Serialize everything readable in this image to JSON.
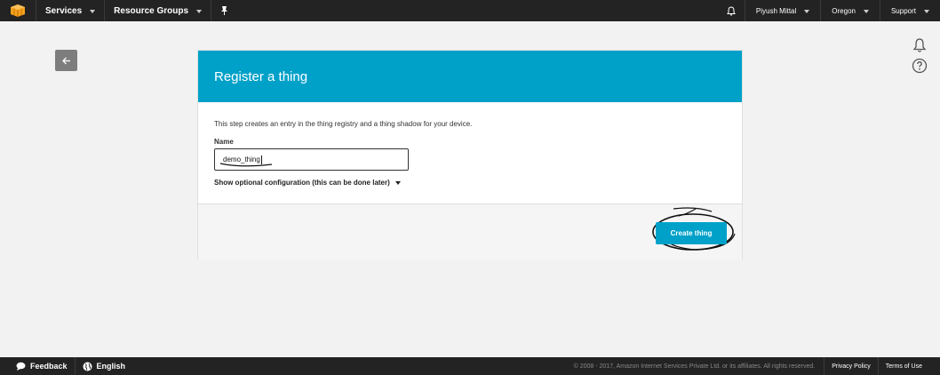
{
  "topbar": {
    "services_label": "Services",
    "resource_groups_label": "Resource Groups",
    "user_label": "Piyush Mittal",
    "region_label": "Oregon",
    "support_label": "Support"
  },
  "panel": {
    "title": "Register a thing",
    "description": "This step creates an entry in the thing registry and a thing shadow for your device.",
    "name_label": "Name",
    "name_value": "demo_thing",
    "optional_config_label": "Show optional configuration (this can be done later)",
    "create_button_label": "Create thing"
  },
  "footer": {
    "feedback_label": "Feedback",
    "language_label": "English",
    "copyright": "© 2008 - 2017, Amazon Internet Services Private Ltd. or its affiliates. All rights reserved.",
    "privacy_label": "Privacy Policy",
    "terms_label": "Terms of Use"
  },
  "colors": {
    "accent": "#00a1c9",
    "topbar": "#232323",
    "aws_orange": "#f7a11c"
  },
  "icons": [
    "aws-logo-icon",
    "pin-icon",
    "bell-icon",
    "back-arrow-icon",
    "help-icon",
    "speech-bubble-icon",
    "globe-icon"
  ]
}
